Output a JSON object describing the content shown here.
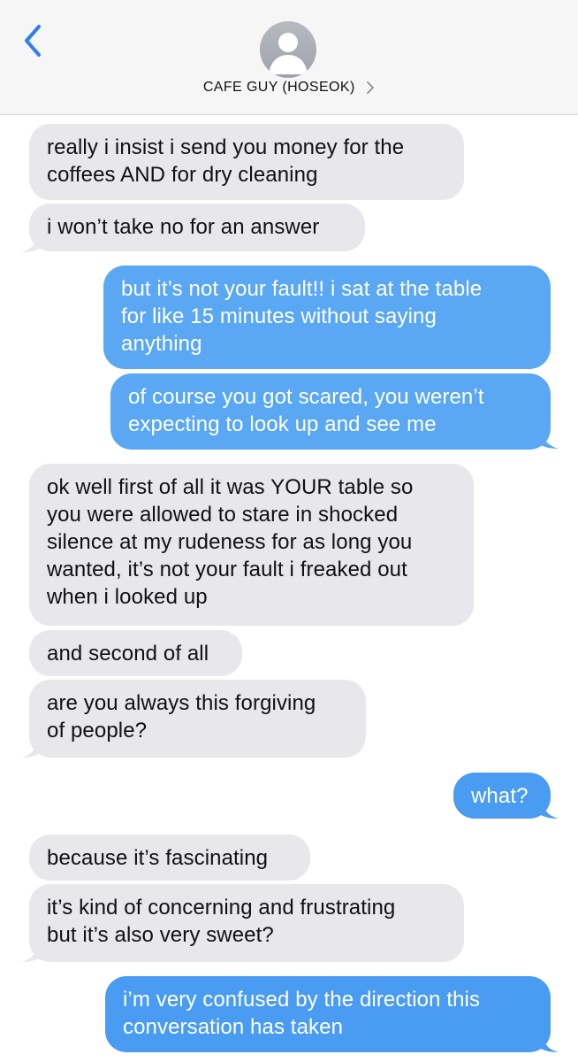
{
  "header": {
    "contact_name": "CAFE GUY (HOSEOK)",
    "back_icon": "chevron-left-icon",
    "avatar_icon": "person-icon",
    "detail_icon": "chevron-right-icon"
  },
  "colors": {
    "incoming_bubble": "#e7e7ec",
    "outgoing_bubble": "#4a9cf3",
    "accent": "#2f80ed"
  },
  "messages": [
    {
      "side": "incoming",
      "text": "really i insist i send you money for the\ncoffees AND for dry cleaning"
    },
    {
      "side": "incoming",
      "text": "i won’t take no for an answer"
    },
    {
      "side": "outgoing",
      "text": "but it’s not your fault!! i sat at the table\nfor like 15 minutes without saying\nanything"
    },
    {
      "side": "outgoing",
      "text": "of course you got scared, you weren’t\nexpecting to look up and see me"
    },
    {
      "side": "incoming",
      "text": "ok well first of all it was YOUR table so\nyou were allowed to stare in shocked\nsilence at my rudeness for as long you\nwanted, it’s not your fault i freaked out\nwhen i looked up"
    },
    {
      "side": "incoming",
      "text": "and second of all"
    },
    {
      "side": "incoming",
      "text": "are you always this forgiving\nof people?"
    },
    {
      "side": "outgoing",
      "text": "what?"
    },
    {
      "side": "incoming",
      "text": "because it’s fascinating"
    },
    {
      "side": "incoming",
      "text": "it’s kind of concerning and frustrating\nbut it’s also very sweet?"
    },
    {
      "side": "outgoing",
      "text": "i’m very confused by the direction this\nconversation has taken"
    }
  ]
}
